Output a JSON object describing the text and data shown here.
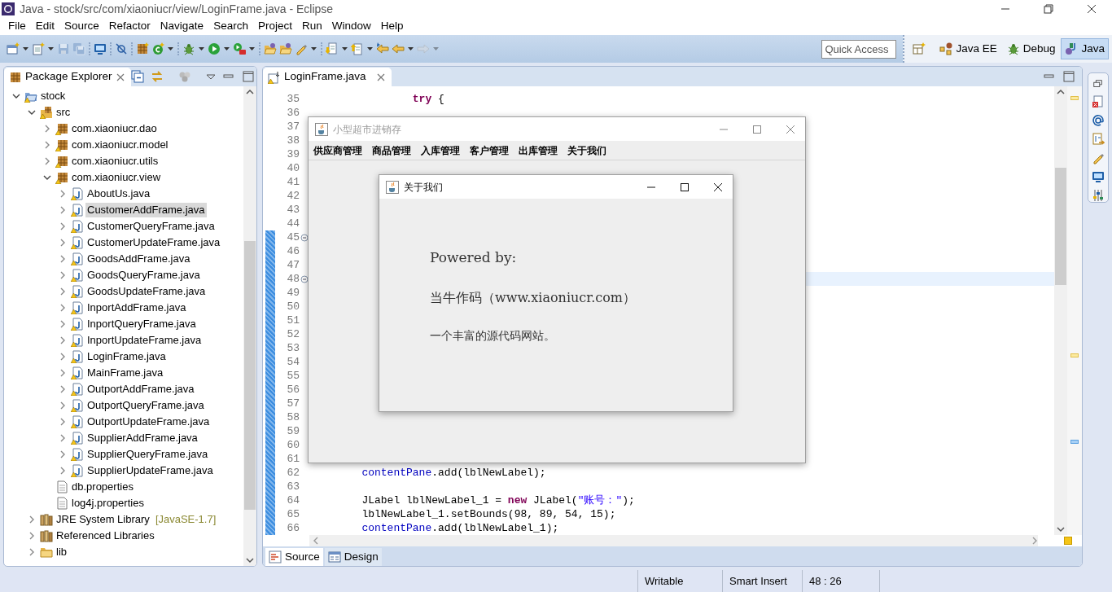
{
  "window": {
    "title": "Java - stock/src/com/xiaoniucr/view/LoginFrame.java - Eclipse"
  },
  "menu": [
    "File",
    "Edit",
    "Source",
    "Refactor",
    "Navigate",
    "Search",
    "Project",
    "Run",
    "Window",
    "Help"
  ],
  "toolbar": [
    [
      {
        "kind": "new",
        "dropdown": true,
        "disabled": false
      },
      {
        "kind": "newtype",
        "dropdown": true,
        "disabled": false
      },
      {
        "kind": "save",
        "dropdown": false,
        "disabled": true
      },
      {
        "kind": "saveall",
        "dropdown": false,
        "disabled": true
      }
    ],
    [
      {
        "kind": "terminal",
        "dropdown": false,
        "disabled": false
      }
    ],
    [
      {
        "kind": "skip",
        "dropdown": false,
        "disabled": false
      }
    ],
    [
      {
        "kind": "package",
        "dropdown": false,
        "disabled": false
      },
      {
        "kind": "newclass",
        "dropdown": true,
        "disabled": false
      }
    ],
    [
      {
        "kind": "debug",
        "dropdown": true,
        "disabled": false
      },
      {
        "kind": "run",
        "dropdown": true,
        "disabled": false
      },
      {
        "kind": "external",
        "dropdown": true,
        "disabled": false
      }
    ],
    [
      {
        "kind": "openfolder",
        "dropdown": false,
        "disabled": false
      },
      {
        "kind": "openfolder",
        "dropdown": false,
        "disabled": false
      },
      {
        "kind": "pen",
        "dropdown": true,
        "disabled": false
      }
    ],
    [
      {
        "kind": "nextann",
        "dropdown": true,
        "disabled": false
      },
      {
        "kind": "prevann",
        "dropdown": true,
        "disabled": false
      },
      {
        "kind": "lastedit",
        "dropdown": false,
        "disabled": false
      },
      {
        "kind": "back",
        "dropdown": true,
        "disabled": false
      },
      {
        "kind": "forward",
        "dropdown": true,
        "disabled": true
      }
    ]
  ],
  "quick_access": {
    "placeholder": "Quick Access"
  },
  "perspectives": [
    {
      "label": "Java EE",
      "kind": "javaee",
      "selected": false
    },
    {
      "label": "Debug",
      "kind": "debug",
      "selected": false
    },
    {
      "label": "Java",
      "kind": "java",
      "selected": true
    }
  ],
  "package_explorer": {
    "title": "Package Explorer",
    "tree": [
      {
        "label": "stock",
        "kind": "project",
        "expanded": true,
        "selected": false,
        "warning": true,
        "children": [
          {
            "label": "src",
            "kind": "srcfolder",
            "expanded": true,
            "selected": false,
            "warning": true,
            "children": [
              {
                "label": "com.xiaoniucr.dao",
                "kind": "package",
                "expanded": false,
                "selected": false,
                "warning": true
              },
              {
                "label": "com.xiaoniucr.model",
                "kind": "package",
                "expanded": false,
                "selected": false,
                "warning": true
              },
              {
                "label": "com.xiaoniucr.utils",
                "kind": "package",
                "expanded": false,
                "selected": false,
                "warning": true
              },
              {
                "label": "com.xiaoniucr.view",
                "kind": "package",
                "expanded": true,
                "selected": false,
                "warning": true,
                "children": [
                  {
                    "label": "AboutUs.java",
                    "kind": "java",
                    "expanded": false,
                    "selected": false,
                    "warning": true
                  },
                  {
                    "label": "CustomerAddFrame.java",
                    "kind": "java",
                    "expanded": false,
                    "selected": true,
                    "warning": true
                  },
                  {
                    "label": "CustomerQueryFrame.java",
                    "kind": "java",
                    "expanded": false,
                    "selected": false,
                    "warning": true
                  },
                  {
                    "label": "CustomerUpdateFrame.java",
                    "kind": "java",
                    "expanded": false,
                    "selected": false,
                    "warning": true
                  },
                  {
                    "label": "GoodsAddFrame.java",
                    "kind": "java",
                    "expanded": false,
                    "selected": false,
                    "warning": true
                  },
                  {
                    "label": "GoodsQueryFrame.java",
                    "kind": "java",
                    "expanded": false,
                    "selected": false,
                    "warning": true
                  },
                  {
                    "label": "GoodsUpdateFrame.java",
                    "kind": "java",
                    "expanded": false,
                    "selected": false,
                    "warning": true
                  },
                  {
                    "label": "InportAddFrame.java",
                    "kind": "java",
                    "expanded": false,
                    "selected": false,
                    "warning": true
                  },
                  {
                    "label": "InportQueryFrame.java",
                    "kind": "java",
                    "expanded": false,
                    "selected": false,
                    "warning": true
                  },
                  {
                    "label": "InportUpdateFrame.java",
                    "kind": "java",
                    "expanded": false,
                    "selected": false,
                    "warning": true
                  },
                  {
                    "label": "LoginFrame.java",
                    "kind": "java",
                    "expanded": false,
                    "selected": false,
                    "warning": true
                  },
                  {
                    "label": "MainFrame.java",
                    "kind": "java",
                    "expanded": false,
                    "selected": false,
                    "warning": true
                  },
                  {
                    "label": "OutportAddFrame.java",
                    "kind": "java",
                    "expanded": false,
                    "selected": false,
                    "warning": true
                  },
                  {
                    "label": "OutportQueryFrame.java",
                    "kind": "java",
                    "expanded": false,
                    "selected": false,
                    "warning": true
                  },
                  {
                    "label": "OutportUpdateFrame.java",
                    "kind": "java",
                    "expanded": false,
                    "selected": false,
                    "warning": true
                  },
                  {
                    "label": "SupplierAddFrame.java",
                    "kind": "java",
                    "expanded": false,
                    "selected": false,
                    "warning": true
                  },
                  {
                    "label": "SupplierQueryFrame.java",
                    "kind": "java",
                    "expanded": false,
                    "selected": false,
                    "warning": true
                  },
                  {
                    "label": "SupplierUpdateFrame.java",
                    "kind": "java",
                    "expanded": false,
                    "selected": false,
                    "warning": true
                  }
                ]
              },
              {
                "label": "db.properties",
                "kind": "file",
                "selected": false,
                "warning": false
              },
              {
                "label": "log4j.properties",
                "kind": "file",
                "selected": false,
                "warning": false
              }
            ]
          },
          {
            "label": "JRE System Library",
            "decoration": "[JavaSE-1.7]",
            "kind": "library",
            "expanded": false,
            "selected": false,
            "warning": false
          },
          {
            "label": "Referenced Libraries",
            "kind": "library",
            "expanded": false,
            "selected": false,
            "warning": false
          },
          {
            "label": "lib",
            "kind": "folder",
            "expanded": false,
            "selected": false,
            "warning": false
          }
        ]
      }
    ]
  },
  "editor": {
    "tab": "LoginFrame.java",
    "lines": [
      {
        "number": "35",
        "tokens": [
          {
            "text": "                try",
            "kind": "keyword"
          },
          {
            "text": " {",
            "kind": "plain"
          }
        ],
        "fold": false,
        "current": false,
        "changed": false
      },
      {
        "number": "36",
        "fold": false,
        "current": false,
        "changed": false
      },
      {
        "number": "37",
        "fold": false,
        "current": false,
        "changed": false
      },
      {
        "number": "38",
        "fold": false,
        "current": false,
        "changed": false
      },
      {
        "number": "39",
        "fold": false,
        "current": false,
        "changed": false
      },
      {
        "number": "40",
        "fold": false,
        "current": false,
        "changed": false
      },
      {
        "number": "41",
        "fold": false,
        "current": false,
        "changed": false
      },
      {
        "number": "42",
        "fold": false,
        "current": false,
        "changed": false
      },
      {
        "number": "43",
        "fold": false,
        "current": false,
        "changed": false
      },
      {
        "number": "44",
        "fold": false,
        "current": false,
        "changed": false
      },
      {
        "number": "45",
        "fold": true,
        "current": false,
        "changed": true
      },
      {
        "number": "46",
        "fold": false,
        "current": false,
        "changed": true
      },
      {
        "number": "47",
        "fold": false,
        "current": false,
        "changed": true
      },
      {
        "number": "48",
        "fold": true,
        "current": true,
        "changed": true
      },
      {
        "number": "49",
        "fold": false,
        "current": false,
        "changed": true
      },
      {
        "number": "50",
        "fold": false,
        "current": false,
        "changed": true
      },
      {
        "number": "51",
        "fold": false,
        "current": false,
        "changed": true
      },
      {
        "number": "52",
        "fold": false,
        "current": false,
        "changed": true
      },
      {
        "number": "53",
        "fold": false,
        "current": false,
        "changed": true
      },
      {
        "number": "54",
        "fold": false,
        "current": false,
        "changed": true
      },
      {
        "number": "55",
        "fold": false,
        "current": false,
        "changed": true
      },
      {
        "number": "56",
        "fold": false,
        "current": false,
        "changed": true
      },
      {
        "number": "57",
        "fold": false,
        "current": false,
        "changed": true
      },
      {
        "number": "58",
        "fold": false,
        "current": false,
        "changed": true
      },
      {
        "number": "59",
        "fold": false,
        "current": false,
        "changed": true
      },
      {
        "number": "60",
        "fold": false,
        "current": false,
        "changed": true
      },
      {
        "number": "61",
        "fold": false,
        "current": false,
        "changed": true
      },
      {
        "number": "62",
        "tokens": [
          {
            "text": "        contentPane",
            "kind": "field"
          },
          {
            "text": ".add(lblNewLabel);",
            "kind": "plain"
          }
        ],
        "fold": false,
        "current": false,
        "changed": true
      },
      {
        "number": "63",
        "fold": false,
        "current": false,
        "changed": true
      },
      {
        "number": "64",
        "tokens": [
          {
            "text": "        JLabel lblNewLabel_1 = ",
            "kind": "plain"
          },
          {
            "text": "new",
            "kind": "keyword"
          },
          {
            "text": " JLabel(",
            "kind": "plain"
          },
          {
            "text": "\"账号：\"",
            "kind": "string"
          },
          {
            "text": ");",
            "kind": "plain"
          }
        ],
        "fold": false,
        "current": false,
        "changed": true
      },
      {
        "number": "65",
        "tokens": [
          {
            "text": "        lblNewLabel_1.setBounds(98, 89, 54, 15);",
            "kind": "plain"
          }
        ],
        "fold": false,
        "current": false,
        "changed": true
      },
      {
        "number": "66",
        "tokens": [
          {
            "text": "        contentPane",
            "kind": "field"
          },
          {
            "text": ".add(lblNewLabel_1);",
            "kind": "plain"
          }
        ],
        "fold": false,
        "current": false,
        "changed": true
      }
    ],
    "bottom_tabs": [
      {
        "label": "Source",
        "kind": "source",
        "selected": true
      },
      {
        "label": "Design",
        "kind": "design",
        "selected": false
      }
    ]
  },
  "app_window": {
    "title": "小型超市进销存",
    "active": false,
    "menu": [
      "供应商管理",
      "商品管理",
      "入库管理",
      "客户管理",
      "出库管理",
      "关于我们"
    ]
  },
  "dialog": {
    "title": "关于我们",
    "active": true,
    "texts": [
      {
        "text": "Powered by:",
        "kind": "heading"
      },
      {
        "text": "当牛作码（www.xiaoniucr.com）",
        "kind": "site"
      },
      {
        "text": "一个丰富的源代码网站。",
        "kind": "note"
      }
    ]
  },
  "status_bar": [
    "Writable",
    "Smart Insert",
    "48 : 26"
  ]
}
